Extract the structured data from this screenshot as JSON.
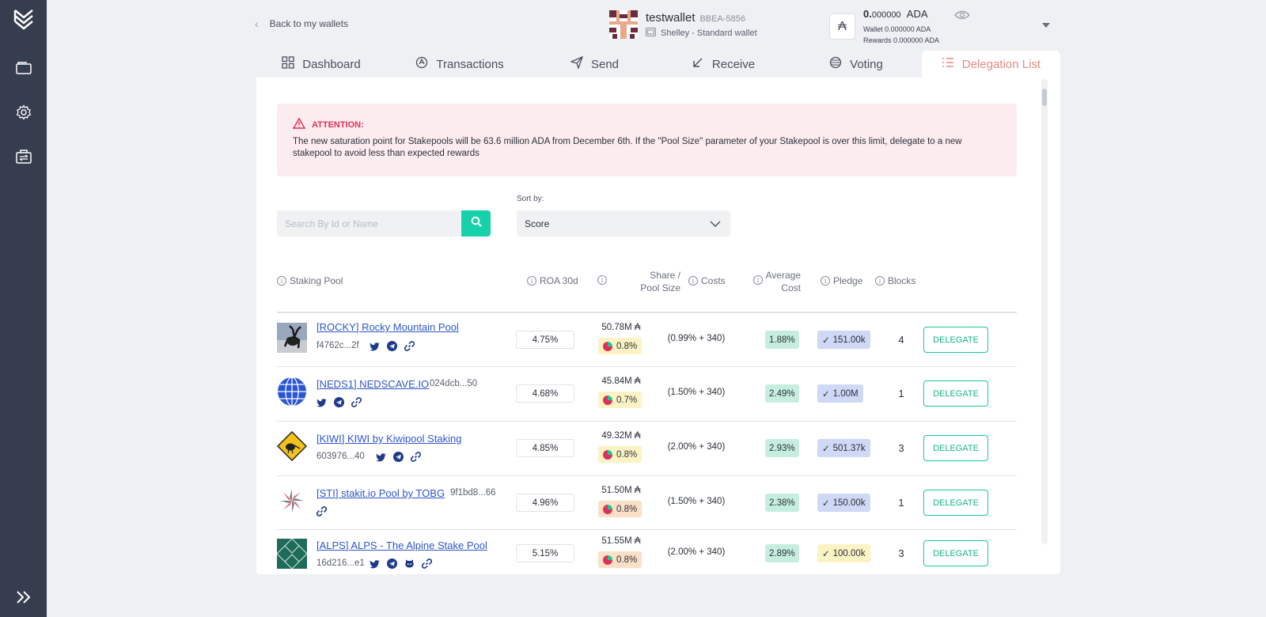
{
  "header": {
    "back_label": "Back to my wallets",
    "wallet_name": "testwallet",
    "wallet_id": "BBEA-5856",
    "wallet_type": "Shelley - Standard wallet",
    "balance_int": "0.",
    "balance_dec": "000000",
    "balance_unit": "ADA",
    "wallet_line": "Wallet 0.000000 ADA",
    "rewards_line": "Rewards 0.000000 ADA",
    "ada_symbol": "₳"
  },
  "tabs": [
    {
      "label": "Dashboard",
      "icon": "dashboard-icon"
    },
    {
      "label": "Transactions",
      "icon": "transactions-icon"
    },
    {
      "label": "Send",
      "icon": "send-icon"
    },
    {
      "label": "Receive",
      "icon": "receive-icon"
    },
    {
      "label": "Voting",
      "icon": "voting-icon"
    },
    {
      "label": "Delegation List",
      "icon": "list-icon",
      "active": true
    }
  ],
  "alert": {
    "title": "ATTENTION:",
    "text": "The new saturation point for Stakepools will be 63.6 million ADA from December 6th. If the \"Pool Size\" parameter of your Stakepool is over this limit, delegate to a new stakepool to avoid less than expected rewards"
  },
  "search": {
    "placeholder": "Search By Id or Name"
  },
  "sort": {
    "label": "Sort by:",
    "value": "Score"
  },
  "table": {
    "headers": {
      "pool": "Staking Pool",
      "roa": "ROA 30d",
      "share_1": "Share /",
      "share_2": "Pool Size",
      "costs": "Costs",
      "avg_1": "Average",
      "avg_2": "Cost",
      "pledge": "Pledge",
      "blocks": "Blocks"
    },
    "delegate_label": "DELEGATE",
    "rows": [
      {
        "name": "[ROCKY] Rocky Mountain Pool",
        "id": "f4762c...2f",
        "roa": "4.75%",
        "share_amt": "50.78M ₳",
        "share_pct": "0.8%",
        "costs": "(0.99% + 340)",
        "avg": "1.88%",
        "pledge": "151.00k",
        "blocks": "4"
      },
      {
        "name": "[NEDS1] NEDSCAVE.IO",
        "id": "024dcb...50",
        "roa": "4.68%",
        "share_amt": "45.84M ₳",
        "share_pct": "0.7%",
        "costs": "(1.50% + 340)",
        "avg": "2.49%",
        "pledge": "1.00M",
        "blocks": "1"
      },
      {
        "name": "[KIWI] KIWI by Kiwipool Staking",
        "id": "603976...40",
        "roa": "4.85%",
        "share_amt": "49.32M ₳",
        "share_pct": "0.8%",
        "costs": "(2.00% + 340)",
        "avg": "2.93%",
        "pledge": "501.37k",
        "blocks": "3"
      },
      {
        "name": "[STI] stakit.io Pool by TOBG",
        "id": "9f1bd8...66",
        "roa": "4.96%",
        "share_amt": "51.50M ₳",
        "share_pct": "0.8%",
        "costs": "(1.50% + 340)",
        "avg": "2.38%",
        "pledge": "150.00k",
        "blocks": "1"
      },
      {
        "name": "[ALPS] ALPS - The Alpine Stake Pool",
        "id": "16d216...e1",
        "roa": "5.15%",
        "share_amt": "51.55M ₳",
        "share_pct": "0.8%",
        "costs": "(2.00% + 340)",
        "avg": "2.89%",
        "pledge": "100.00k",
        "blocks": "3"
      }
    ]
  },
  "colors": {
    "sidebar": "#363d4f",
    "accent": "#17d1aa",
    "active_tab": "#e88a80",
    "alert_bg": "#fdecef",
    "alert_title": "#e0305a",
    "link": "#2e57c9"
  }
}
